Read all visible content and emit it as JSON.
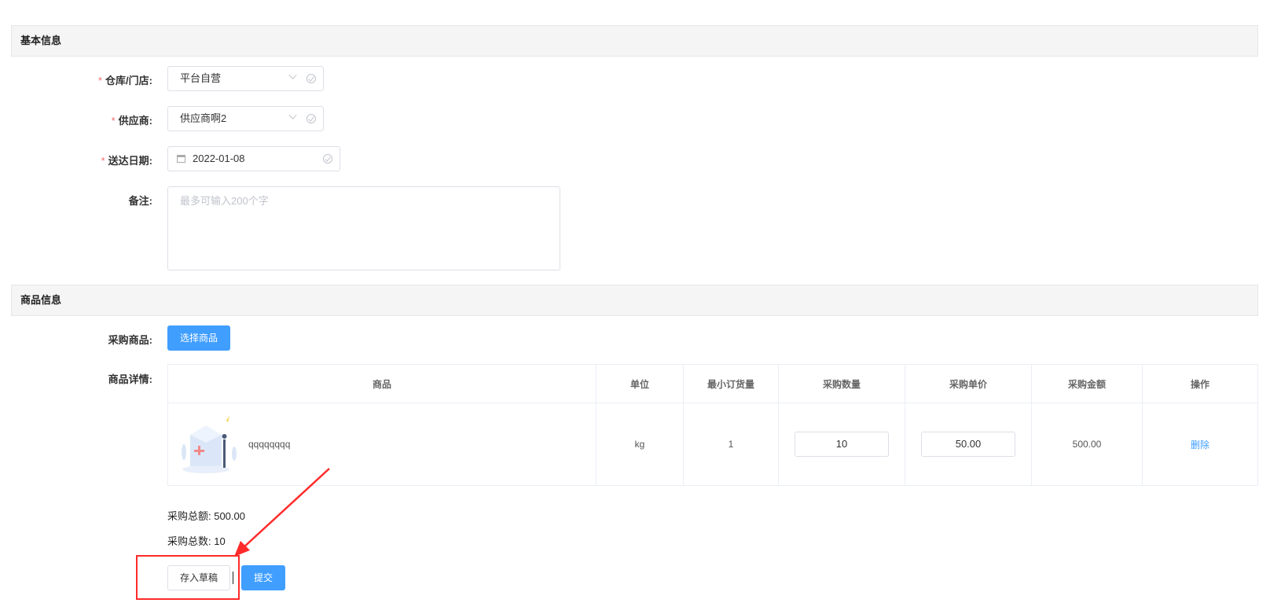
{
  "sections": {
    "basic": "基本信息",
    "goods": "商品信息"
  },
  "form": {
    "warehouse": {
      "label": "仓库/门店:",
      "value": "平台自营"
    },
    "supplier": {
      "label": "供应商:",
      "value": "供应商啊2"
    },
    "delivery_date": {
      "label": "送达日期:",
      "value": "2022-01-08"
    },
    "remark": {
      "label": "备注:",
      "placeholder": "最多可输入200个字"
    },
    "required_mark": "*"
  },
  "goods": {
    "purchase_label": "采购商品:",
    "select_button": "选择商品",
    "detail_label": "商品详情:",
    "columns": [
      "商品",
      "单位",
      "最小订货量",
      "采购数量",
      "采购单价",
      "采购金额",
      "操作"
    ],
    "rows": [
      {
        "name": "qqqqqqqq",
        "unit": "kg",
        "min_order": "1",
        "quantity": "10",
        "unit_price": "50.00",
        "amount": "500.00",
        "action": "删除"
      }
    ]
  },
  "summary": {
    "total_amount": "采购总额: 500.00",
    "total_count": "采购总数: 10"
  },
  "actions": {
    "save_draft": "存入草稿",
    "submit": "提交"
  },
  "colors": {
    "primary": "#409eff",
    "required": "#f56c6c",
    "annotation": "#ff2a2a"
  }
}
